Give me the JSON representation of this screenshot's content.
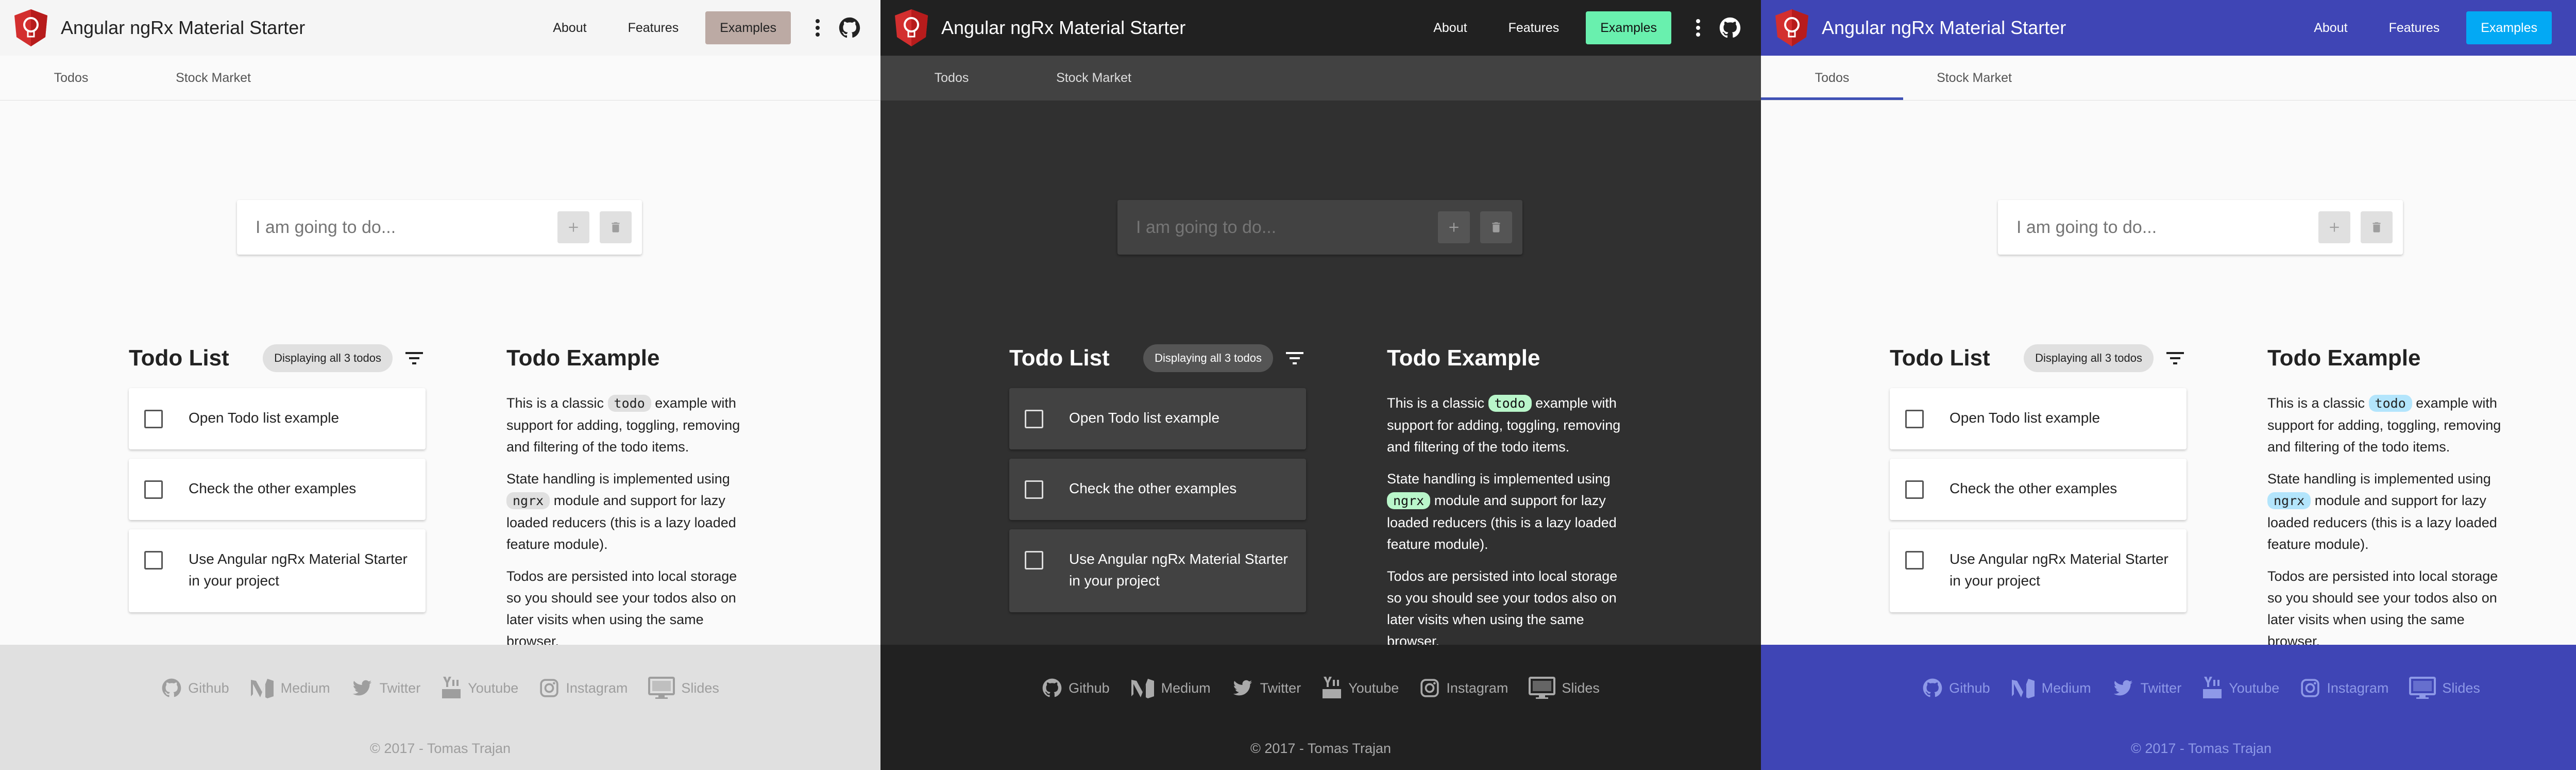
{
  "app": {
    "brand": "Angular ngRx Material Starter",
    "nav": [
      "About",
      "Features",
      "Examples"
    ],
    "active_nav": "Examples"
  },
  "tabs": [
    "Todos",
    "Stock Market"
  ],
  "add": {
    "placeholder": "I am going to do..."
  },
  "todo_list": {
    "title": "Todo List",
    "filter_chip": "Displaying all 3 todos",
    "items": [
      {
        "label": "Open Todo list example",
        "checked": false
      },
      {
        "label": "Check the other examples",
        "checked": false
      },
      {
        "label": "Use Angular ngRx Material Starter in your project",
        "checked": false
      }
    ]
  },
  "info": {
    "title": "Todo Example",
    "p1_pre": "This is a classic ",
    "p1_code": "todo",
    "p1_post": " example with support for adding, toggling, removing and filtering of the todo items.",
    "p2_pre": "State handling is implemented using ",
    "p2_code": "ngrx",
    "p2_post": " module and support for lazy loaded reducers (this is a lazy loaded feature module).",
    "p3": "Todos are persisted into local storage so you should see your todos also on later visits when using the same browser."
  },
  "footer": {
    "links": [
      "Github",
      "Medium",
      "Twitter",
      "Youtube",
      "Instagram",
      "Slides"
    ],
    "copyright": "© 2017 - Tomas Trajan"
  },
  "themes": [
    {
      "name": "light",
      "accent": "#bcaaa4"
    },
    {
      "name": "dark",
      "accent": "#69f0ae"
    },
    {
      "name": "blue",
      "accent": "#03a9f4",
      "primary": "#3f51b5"
    }
  ],
  "icons": [
    "logo-bulb-icon",
    "more-vert-icon",
    "github-icon",
    "add-icon",
    "delete-icon",
    "filter-icon",
    "medium-icon",
    "twitter-icon",
    "youtube-icon",
    "instagram-icon",
    "slides-icon"
  ]
}
